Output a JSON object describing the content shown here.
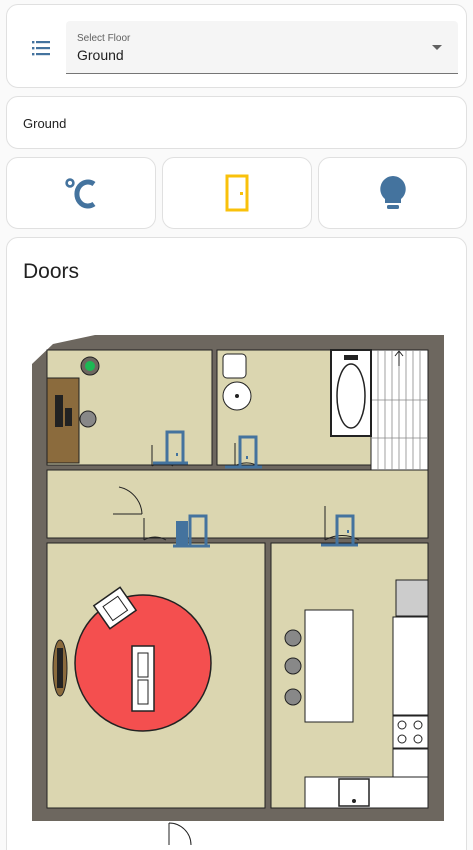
{
  "floor_select": {
    "label": "Select Floor",
    "value": "Ground"
  },
  "header": {
    "title": "Ground"
  },
  "view_buttons": {
    "temperature_icon": "celsius-icon",
    "doors_icon": "door-icon",
    "lights_icon": "lightbulb-icon"
  },
  "colors": {
    "accent": "#44739e",
    "door_active": "#f9c10b",
    "wall": "#6d675f",
    "floor": "#dbd6b0",
    "rug": "#f44f4f"
  },
  "plan": {
    "title": "Doors"
  }
}
